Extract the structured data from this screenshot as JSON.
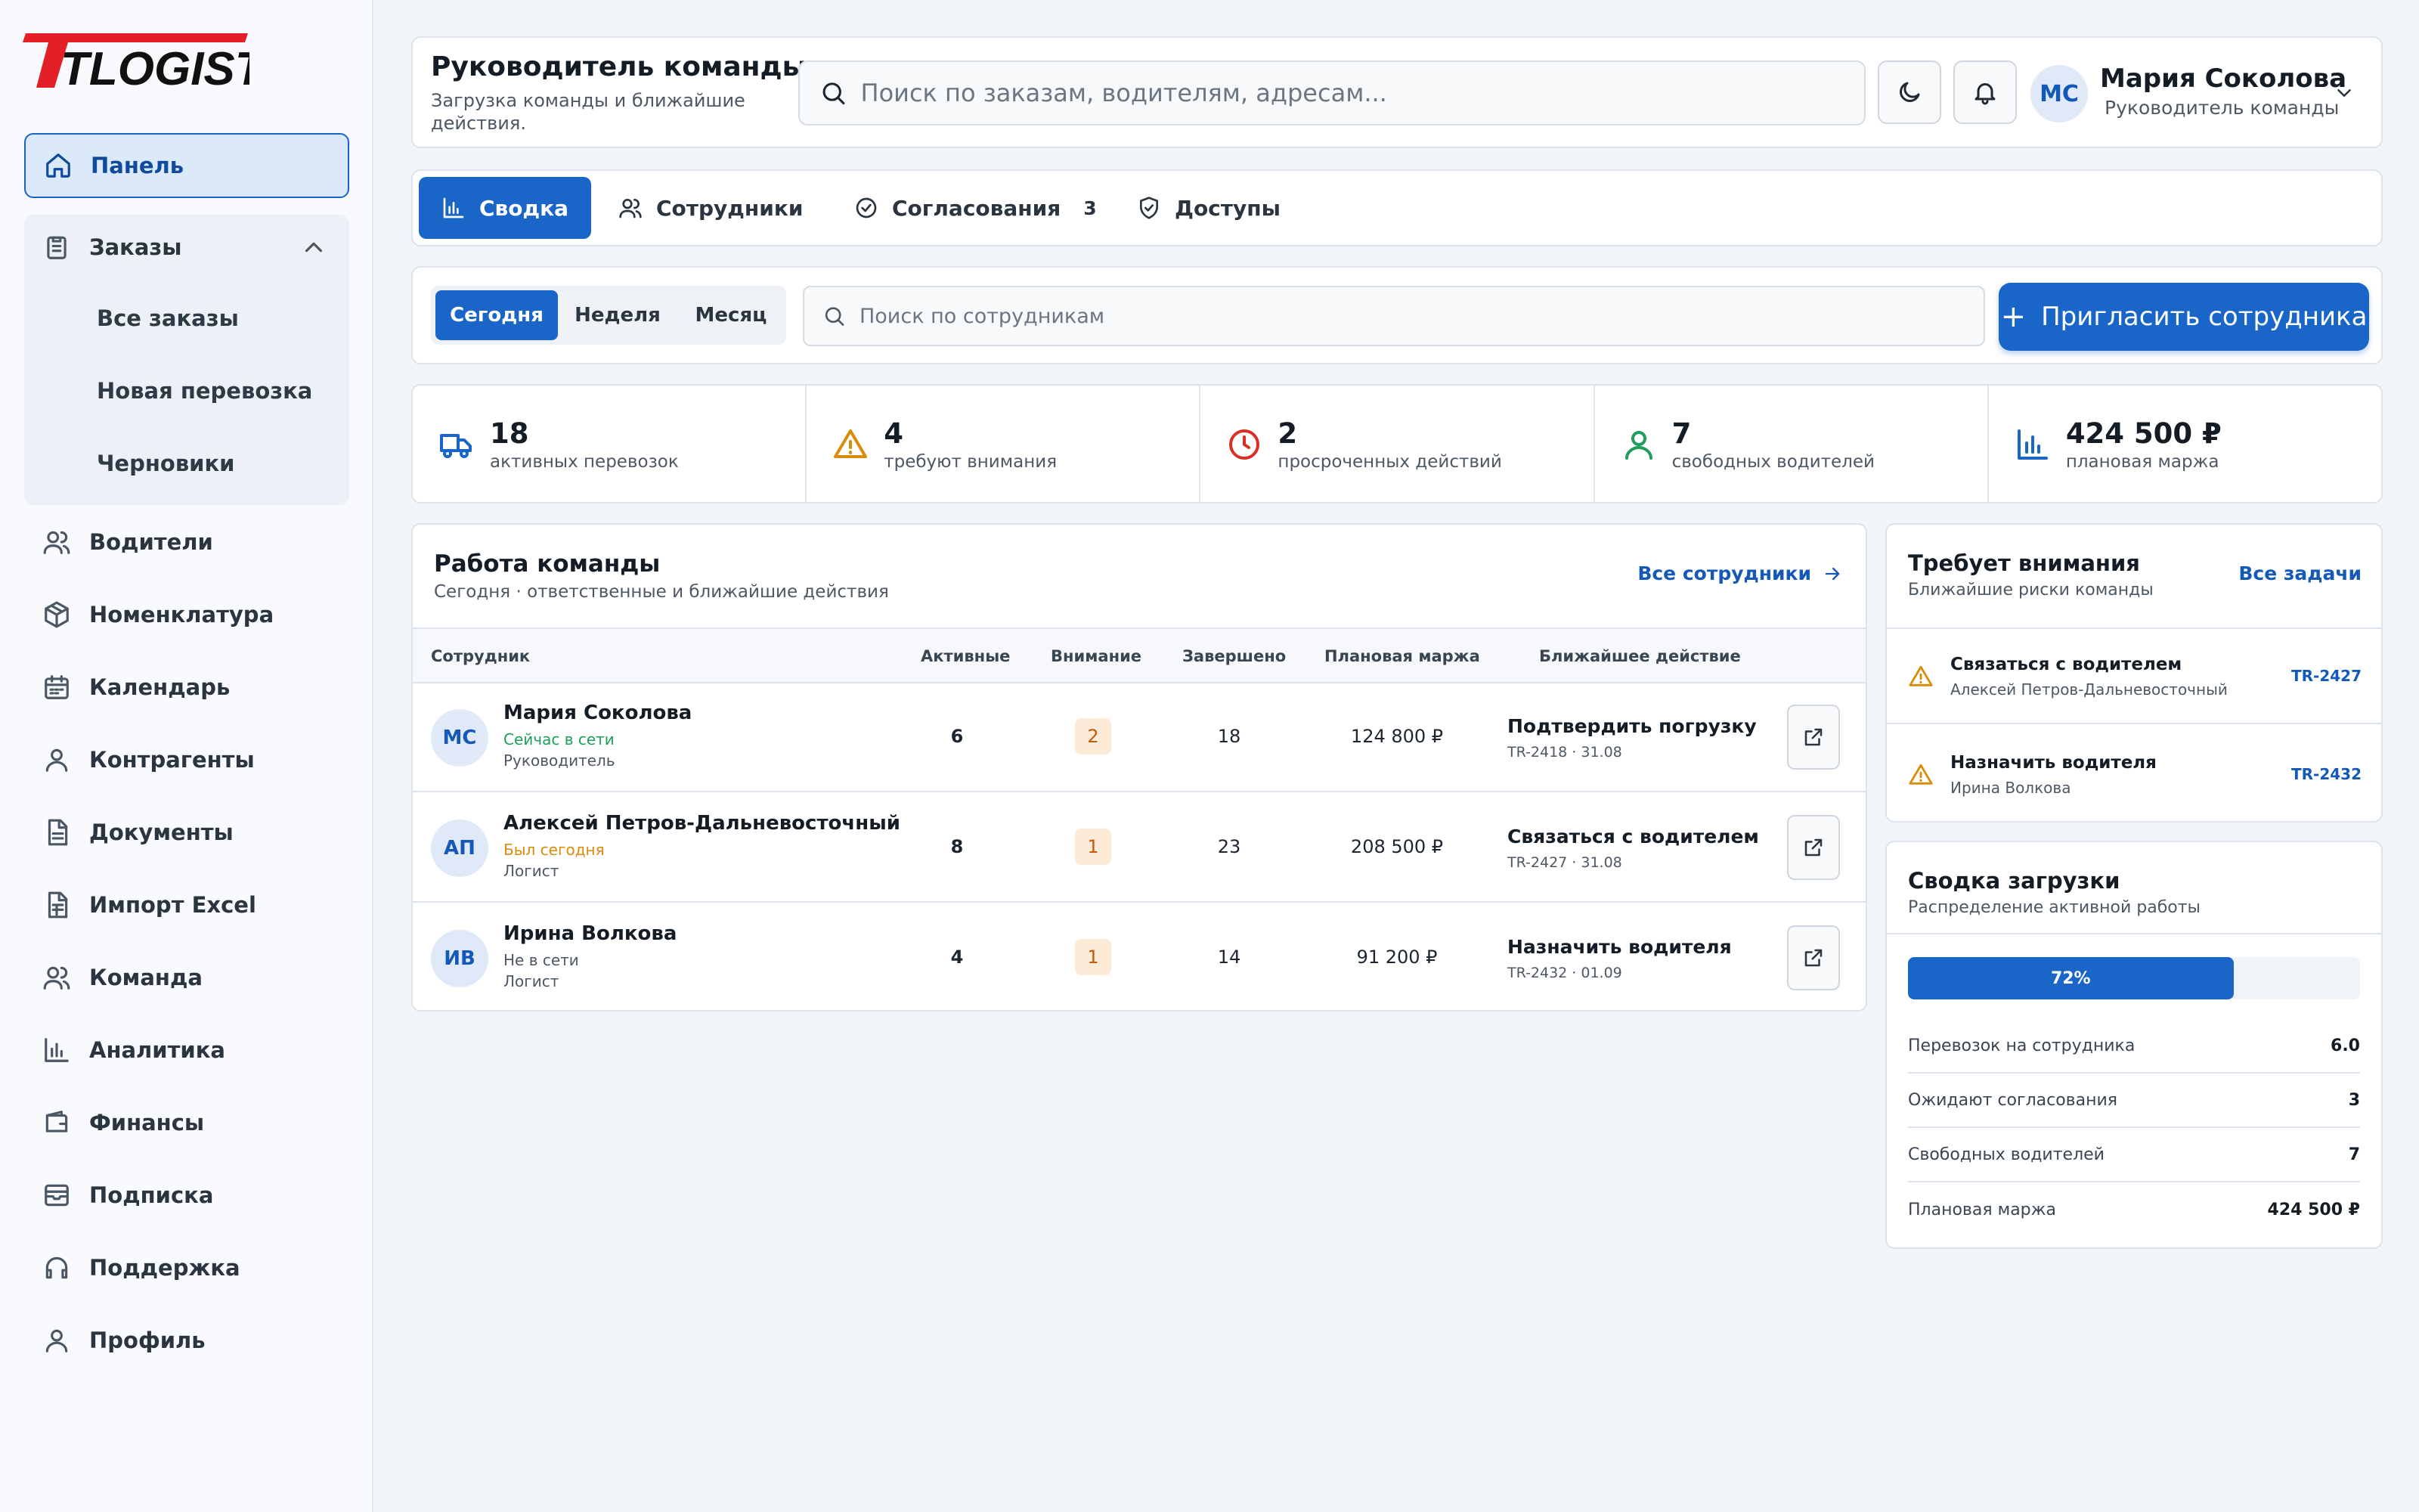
{
  "brand": {
    "logo_text": "TLOGIST",
    "color": "#e32028"
  },
  "sidebar": {
    "items": [
      {
        "label": "Панель",
        "icon": "home-icon"
      },
      {
        "label": "Заказы",
        "icon": "clipboard-icon"
      },
      {
        "label": "Водители",
        "icon": "users-icon"
      },
      {
        "label": "Номенклатура",
        "icon": "box-icon"
      },
      {
        "label": "Календарь",
        "icon": "calendar-icon"
      },
      {
        "label": "Контрагенты",
        "icon": "user-icon"
      },
      {
        "label": "Документы",
        "icon": "document-icon"
      },
      {
        "label": "Импорт Excel",
        "icon": "spreadsheet-icon"
      },
      {
        "label": "Команда",
        "icon": "team-icon"
      },
      {
        "label": "Аналитика",
        "icon": "bar-chart-icon"
      },
      {
        "label": "Финансы",
        "icon": "wallet-icon"
      },
      {
        "label": "Подписка",
        "icon": "subscription-icon"
      },
      {
        "label": "Поддержка",
        "icon": "headset-icon"
      },
      {
        "label": "Профиль",
        "icon": "profile-icon"
      }
    ],
    "orders_sub": [
      "Все заказы",
      "Новая перевозка",
      "Черновики"
    ]
  },
  "header": {
    "title": "Руководитель команды",
    "subtitle": "Загрузка команды и ближайшие действия.",
    "search_placeholder": "Поиск по заказам, водителям, адресам...",
    "user": {
      "initials": "МС",
      "name": "Мария Соколова",
      "role": "Руководитель команды"
    }
  },
  "tabs": [
    {
      "label": "Сводка",
      "icon": "bar-chart-icon"
    },
    {
      "label": "Сотрудники",
      "icon": "users-icon"
    },
    {
      "label": "Согласования",
      "icon": "check-circle-icon",
      "badge": "3"
    },
    {
      "label": "Доступы",
      "icon": "shield-icon"
    }
  ],
  "filter": {
    "periods": [
      "Сегодня",
      "Неделя",
      "Месяц"
    ],
    "selected_period": "Сегодня",
    "search_placeholder": "Поиск по сотрудникам",
    "invite_label": "Пригласить сотрудника"
  },
  "stats": [
    {
      "value": "18",
      "label": "активных перевозок",
      "icon": "truck-icon",
      "color": "#1a65c8"
    },
    {
      "value": "4",
      "label": "требуют внимания",
      "icon": "warning-icon",
      "color": "#d98b0a"
    },
    {
      "value": "2",
      "label": "просроченных действий",
      "icon": "clock-icon",
      "color": "#d93025"
    },
    {
      "value": "7",
      "label": "свободных водителей",
      "icon": "user-icon",
      "color": "#1e9e5a"
    },
    {
      "value": "424 500 ₽",
      "label": "плановая маржа",
      "icon": "bar-chart-icon",
      "color": "#1a65c8"
    }
  ],
  "team": {
    "title": "Работа команды",
    "subtitle": "Сегодня · ответственные и ближайшие действия",
    "all_link": "Все сотрудники",
    "columns": [
      "Сотрудник",
      "Активные",
      "Внимание",
      "Завершено",
      "Плановая маржа",
      "Ближайшее действие"
    ],
    "rows": [
      {
        "initials": "МС",
        "name": "Мария Соколова",
        "status": "Сейчас в сети",
        "status_color": "#1e9e5a",
        "role": "Руководитель",
        "active": "6",
        "attention": "2",
        "done": "18",
        "margin": "124 800 ₽",
        "action": "Подтвердить погрузку",
        "action_ref": "TR-2418 · 31.08"
      },
      {
        "initials": "АП",
        "name": "Алексей Петров-Дальневосточный",
        "status": "Был сегодня",
        "status_color": "#d98b0a",
        "role": "Логист",
        "active": "8",
        "attention": "1",
        "done": "23",
        "margin": "208 500 ₽",
        "action": "Связаться с водителем",
        "action_ref": "TR-2427 · 31.08"
      },
      {
        "initials": "ИВ",
        "name": "Ирина Волкова",
        "status": "Не в сети",
        "status_color": "#4d5864",
        "role": "Логист",
        "active": "4",
        "attention": "1",
        "done": "14",
        "margin": "91 200 ₽",
        "action": "Назначить водителя",
        "action_ref": "TR-2432 · 01.09"
      }
    ]
  },
  "attention": {
    "title": "Требует внимания",
    "subtitle": "Ближайшие риски команды",
    "all_link": "Все задачи",
    "tasks": [
      {
        "title": "Связаться с водителем",
        "sub": "Алексей Петров-Дальневосточный",
        "id": "TR-2427"
      },
      {
        "title": "Назначить водителя",
        "sub": "Ирина Волкова",
        "id": "TR-2432"
      }
    ]
  },
  "load": {
    "title": "Сводка загрузки",
    "subtitle": "Распределение активной работы",
    "progress": 72,
    "progress_label": "72%",
    "rows": [
      {
        "k": "Перевозок на сотрудника",
        "v": "6.0"
      },
      {
        "k": "Ожидают согласования",
        "v": "3"
      },
      {
        "k": "Свободных водителей",
        "v": "7"
      },
      {
        "k": "Плановая маржа",
        "v": "424 500 ₽"
      }
    ]
  }
}
